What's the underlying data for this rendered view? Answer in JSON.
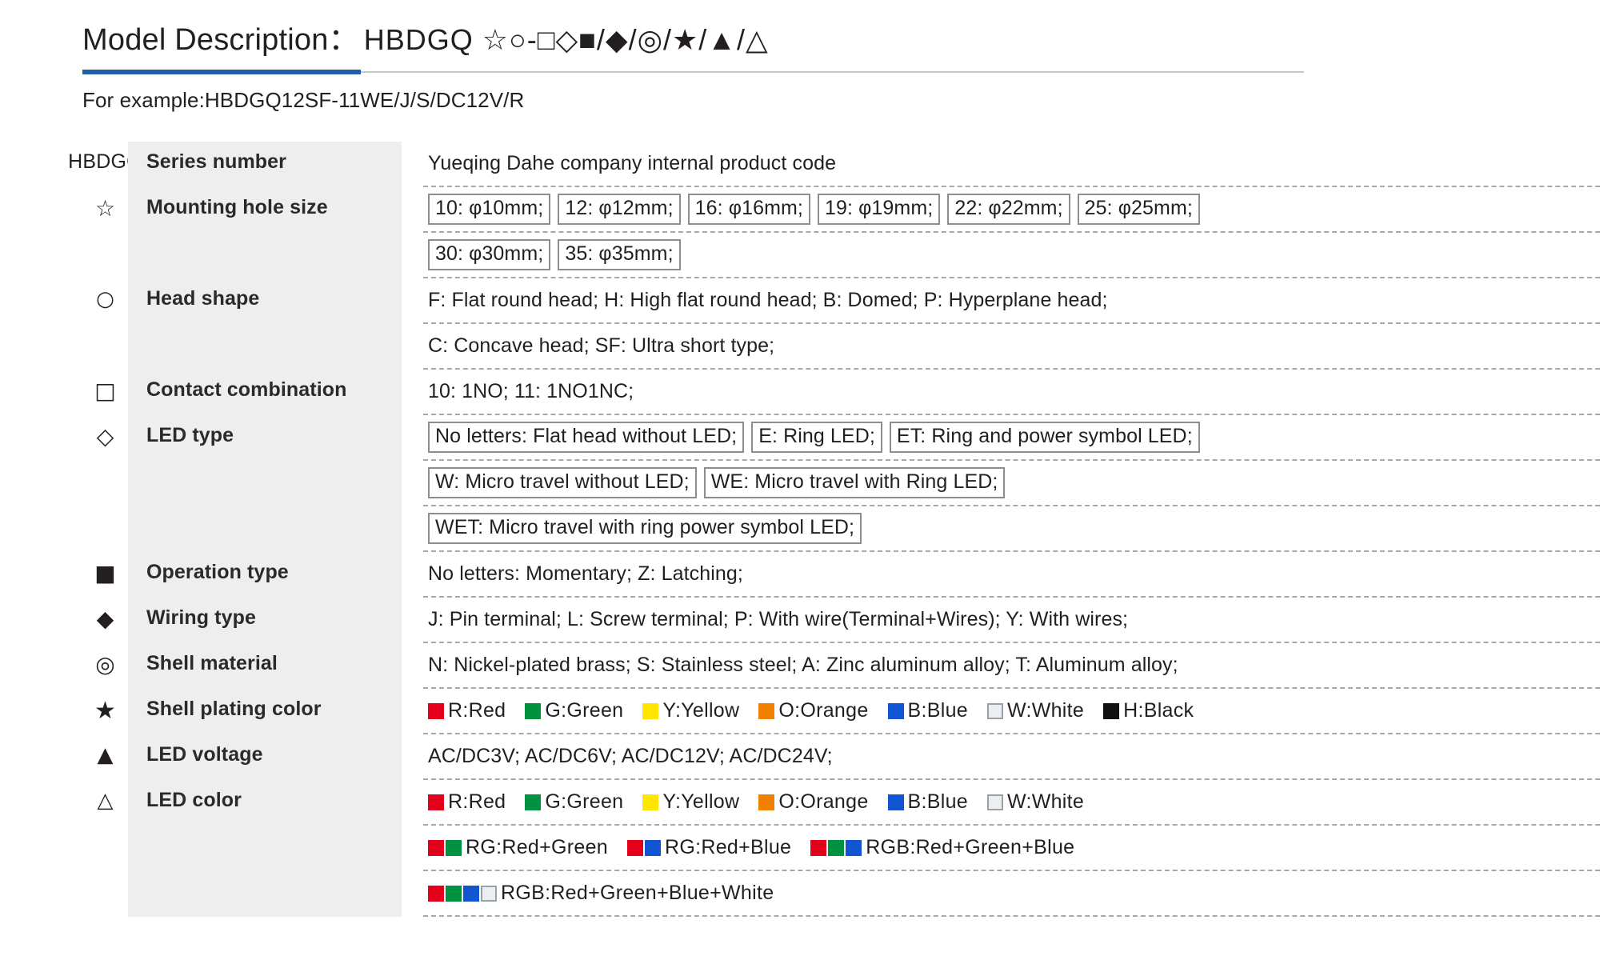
{
  "header": {
    "title_label": "Model Description：",
    "title_code": "HBDGQ ☆○-□◇■/◆/◎/★/▲/△",
    "example": "For example:HBDGQ12SF-11WE/J/S/DC12V/R",
    "accent_color": "#1f5fa8",
    "rule_color": "#c8c8c8"
  },
  "colors": {
    "red": "#e2001a",
    "green": "#00923f",
    "yellow": "#ffe600",
    "orange": "#f08100",
    "blue": "#1255d2",
    "white": "#eceff1",
    "black": "#111111",
    "label_bg": "#eeeeee",
    "dash": "#a8a8a8"
  },
  "rows": [
    {
      "icon": "HBDGQ",
      "icon_kind": "text",
      "label": "Series number",
      "lines": [
        {
          "kind": "text",
          "text": "Yueqing Dahe company internal product code"
        }
      ]
    },
    {
      "icon": "☆",
      "icon_kind": "star-outline",
      "label": "Mounting hole size",
      "lines": [
        {
          "kind": "boxes",
          "items": [
            "10: φ10mm;",
            "12: φ12mm;",
            "16: φ16mm;",
            "19: φ19mm;",
            "22: φ22mm;",
            "25: φ25mm;"
          ]
        },
        {
          "kind": "boxes",
          "items": [
            "30: φ30mm;",
            "35: φ35mm;"
          ]
        }
      ]
    },
    {
      "icon": "○",
      "icon_kind": "circle-outline",
      "label": "Head  shape",
      "lines": [
        {
          "kind": "text",
          "text": "F: Flat round head;   H: High flat round head;   B: Domed;  P: Hyperplane head;"
        },
        {
          "kind": "text",
          "text": "C: Concave head;   SF: Ultra short type;"
        }
      ]
    },
    {
      "icon": "□",
      "icon_kind": "square-outline",
      "label": "Contact combination",
      "lines": [
        {
          "kind": "text",
          "text": "10: 1NO;  11: 1NO1NC;"
        }
      ]
    },
    {
      "icon": "◇",
      "icon_kind": "diamond-outline",
      "label": "LED type",
      "lines": [
        {
          "kind": "boxes",
          "items": [
            "No letters: Flat head without LED;",
            "E: Ring LED;",
            "ET: Ring and power symbol LED;"
          ]
        },
        {
          "kind": "boxes",
          "items": [
            "W: Micro travel without LED;",
            "WE: Micro travel with Ring LED;"
          ]
        },
        {
          "kind": "boxes",
          "items": [
            "WET: Micro travel with ring power symbol LED;"
          ]
        }
      ]
    },
    {
      "icon": "■",
      "icon_kind": "square-filled",
      "label": "Operation type",
      "lines": [
        {
          "kind": "text",
          "text": "No letters: Momentary;   Z: Latching;"
        }
      ]
    },
    {
      "icon": "◆",
      "icon_kind": "diamond-filled",
      "label": "Wiring type",
      "lines": [
        {
          "kind": "text",
          "text": "J: Pin terminal;   L: Screw terminal;   P: With wire(Terminal+Wires);   Y: With wires;"
        }
      ]
    },
    {
      "icon": "◎",
      "icon_kind": "ring",
      "label": "Shell material",
      "lines": [
        {
          "kind": "text",
          "text": "N: Nickel-plated brass;   S: Stainless steel;   A: Zinc aluminum alloy;   T: Aluminum alloy;"
        }
      ]
    },
    {
      "icon": "★",
      "icon_kind": "star-filled",
      "label": "Shell plating color",
      "lines": [
        {
          "kind": "swatches",
          "items": [
            {
              "swatches": [
                "red"
              ],
              "text": "R:Red"
            },
            {
              "swatches": [
                "green"
              ],
              "text": "G:Green"
            },
            {
              "swatches": [
                "yellow"
              ],
              "text": "Y:Yellow"
            },
            {
              "swatches": [
                "orange"
              ],
              "text": "O:Orange"
            },
            {
              "swatches": [
                "blue"
              ],
              "text": "B:Blue"
            },
            {
              "swatches": [
                "white"
              ],
              "text": "W:White"
            },
            {
              "swatches": [
                "black"
              ],
              "text": "H:Black"
            }
          ]
        }
      ]
    },
    {
      "icon": "▲",
      "icon_kind": "triangle-filled",
      "label": "LED voltage",
      "lines": [
        {
          "kind": "text",
          "text": "AC/DC3V;   AC/DC6V;   AC/DC12V;   AC/DC24V;"
        }
      ]
    },
    {
      "icon": "△",
      "icon_kind": "triangle-outline",
      "label": "LED color",
      "lines": [
        {
          "kind": "swatches",
          "items": [
            {
              "swatches": [
                "red"
              ],
              "text": "R:Red"
            },
            {
              "swatches": [
                "green"
              ],
              "text": "G:Green"
            },
            {
              "swatches": [
                "yellow"
              ],
              "text": "Y:Yellow"
            },
            {
              "swatches": [
                "orange"
              ],
              "text": "O:Orange"
            },
            {
              "swatches": [
                "blue"
              ],
              "text": "B:Blue"
            },
            {
              "swatches": [
                "white"
              ],
              "text": "W:White"
            }
          ]
        },
        {
          "kind": "swatches",
          "items": [
            {
              "swatches": [
                "red",
                "green"
              ],
              "text": "RG:Red+Green"
            },
            {
              "swatches": [
                "red",
                "blue"
              ],
              "text": "RG:Red+Blue"
            },
            {
              "swatches": [
                "red",
                "green",
                "blue"
              ],
              "text": "RGB:Red+Green+Blue"
            }
          ]
        },
        {
          "kind": "swatches",
          "items": [
            {
              "swatches": [
                "red",
                "green",
                "blue",
                "white"
              ],
              "text": "RGB:Red+Green+Blue+White"
            }
          ]
        }
      ]
    }
  ]
}
